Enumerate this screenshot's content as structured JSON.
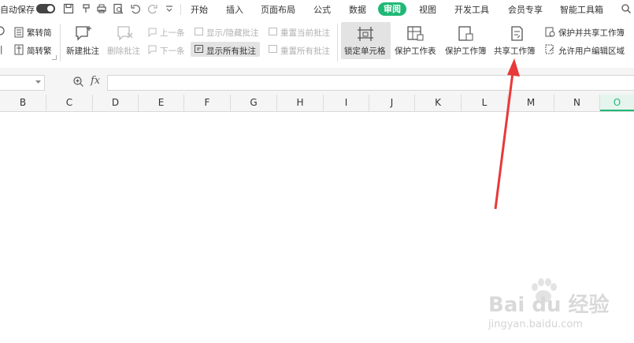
{
  "menubar": {
    "autosave_label": "自动保存",
    "tabs": [
      {
        "label": "开始"
      },
      {
        "label": "插入"
      },
      {
        "label": "页面布局"
      },
      {
        "label": "公式"
      },
      {
        "label": "数据"
      },
      {
        "label": "审阅",
        "active": true
      },
      {
        "label": "视图"
      },
      {
        "label": "开发工具"
      },
      {
        "label": "会员专享"
      },
      {
        "label": "智能工具箱"
      }
    ]
  },
  "ribbon": {
    "trad_simp": "繁转简",
    "simp_trad": "简转繁",
    "new_comment": "新建批注",
    "delete_comment": "删除批注",
    "prev_comment": "上一条",
    "next_comment": "下一条",
    "show_hide_comment": "显示/隐藏批注",
    "show_all_comments": "显示所有批注",
    "reset_current_comment": "重置当前批注",
    "reset_all_comments": "重置所有批注",
    "lock_cell": "锁定单元格",
    "protect_sheet": "保护工作表",
    "protect_workbook": "保护工作簿",
    "share_workbook": "共享工作簿",
    "protect_and_share": "保护并共享工作簿",
    "allow_edit_ranges": "允许用户编辑区域"
  },
  "formula_bar": {
    "fx_label": "fx",
    "namebox_value": "",
    "formula_value": ""
  },
  "columns": [
    "B",
    "C",
    "D",
    "E",
    "F",
    "G",
    "H",
    "I",
    "J",
    "K",
    "L",
    "M",
    "N",
    "O"
  ],
  "selected_column": "O",
  "watermark": {
    "brand": "Bai du 经验",
    "url": "jingyan.baidu.com"
  },
  "colors": {
    "accent": "#1fb876",
    "arrow": "#e8393a"
  }
}
